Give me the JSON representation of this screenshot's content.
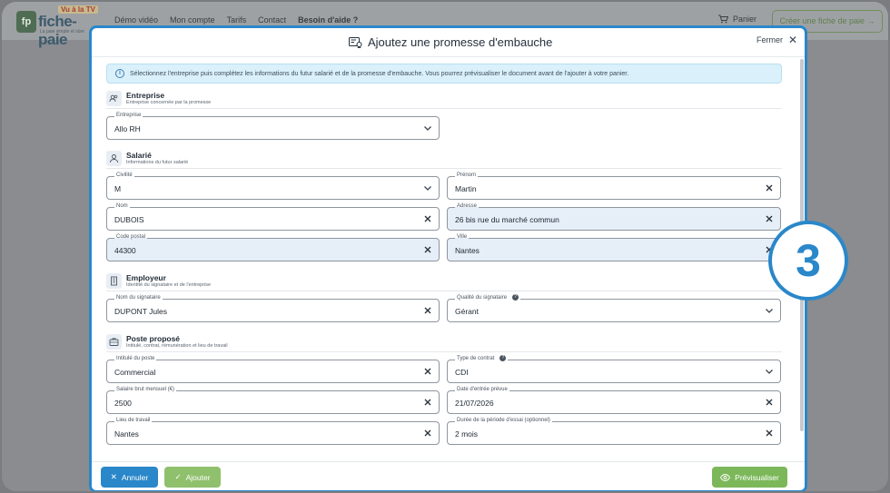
{
  "site": {
    "logo_text": "fiche-paie",
    "logo_tv": "Vu à la TV",
    "logo_tagline": "La paie simple et sûre",
    "logo_badge": "fp",
    "nav": [
      "Démo vidéo",
      "Mon compte",
      "Tarifs",
      "Contact",
      "Besoin d'aide ?"
    ],
    "cart_label": "Panier",
    "cta_label": "Créer une fiche de paie →"
  },
  "modal": {
    "title": "Ajoutez une promesse d'embauche",
    "close_label": "Fermer",
    "info_text": "Sélectionnez l'entreprise puis complétez les informations du futur salarié et de la promesse d'embauche. Vous pourrez prévisualiser le document avant de l'ajouter à votre panier.",
    "sections": {
      "entreprise": {
        "title": "Entreprise",
        "subtitle": "Entreprise concernée par la promesse"
      },
      "salarie": {
        "title": "Salarié",
        "subtitle": "Informations du futur salarié"
      },
      "employeur": {
        "title": "Employeur",
        "subtitle": "Identité du signataire et de l'entreprise"
      },
      "poste": {
        "title": "Poste proposé",
        "subtitle": "Intitulé, contrat, rémunération et lieu de travail"
      }
    },
    "fields": {
      "entreprise": {
        "label": "Entreprise",
        "value": "Allo RH"
      },
      "civilite": {
        "label": "Civilité",
        "value": "M"
      },
      "prenom": {
        "label": "Prénom",
        "value": "Martin"
      },
      "nom": {
        "label": "Nom",
        "value": "DUBOIS"
      },
      "adresse": {
        "label": "Adresse",
        "value": "26 bis rue du marché commun"
      },
      "code_postal": {
        "label": "Code postal",
        "value": "44300"
      },
      "ville": {
        "label": "Ville",
        "value": "Nantes"
      },
      "nom_signataire": {
        "label": "Nom du signataire",
        "value": "DUPONT Jules"
      },
      "qualite_signataire": {
        "label": "Qualité du signataire",
        "value": "Gérant"
      },
      "intitule_poste": {
        "label": "Intitulé du poste",
        "value": "Commercial"
      },
      "type_contrat": {
        "label": "Type de contrat",
        "value": "CDI"
      },
      "salaire": {
        "label": "Salaire brut mensuel (€)",
        "value": "2500"
      },
      "date_entree": {
        "label": "Date d'entrée prévue",
        "value": "21/07/2026"
      },
      "lieu_travail": {
        "label": "Lieu de travail",
        "value": "Nantes"
      },
      "periode_essai": {
        "label": "Durée de la période d'essai (optionnel)",
        "value": "2 mois"
      }
    },
    "buttons": {
      "cancel": "Annuler",
      "add": "Ajouter",
      "preview": "Prévisualiser"
    }
  },
  "step_badge": "3",
  "colors": {
    "accent": "#2a87c9",
    "success": "#7cb85a",
    "info_bg": "#daf0fa"
  }
}
